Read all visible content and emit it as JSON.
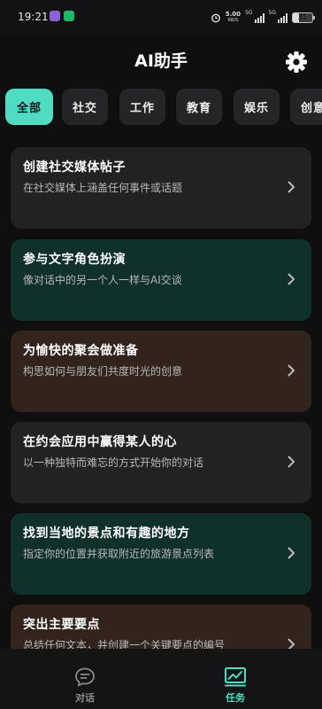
{
  "status_bar": {
    "time": "19:21",
    "net_speed": "5.00",
    "net_unit": "KB/S",
    "sim1_tag": "5G",
    "sim2_tag": "5G",
    "battery": "31"
  },
  "header": {
    "title": "AI助手"
  },
  "tabs": [
    {
      "label": "全部",
      "active": true
    },
    {
      "label": "社交",
      "active": false
    },
    {
      "label": "工作",
      "active": false
    },
    {
      "label": "教育",
      "active": false
    },
    {
      "label": "娱乐",
      "active": false
    },
    {
      "label": "创意",
      "active": false
    }
  ],
  "cards": [
    {
      "title": "创建社交媒体帖子",
      "subtitle": "在社交媒体上涵盖任何事件或话题",
      "color": "#222223"
    },
    {
      "title": "参与文字角色扮演",
      "subtitle": "像对话中的另一个人一样与AI交谈",
      "color": "#10302c"
    },
    {
      "title": "为愉快的聚会做准备",
      "subtitle": "构思如何与朋友们共度时光的创意",
      "color": "#32241c"
    },
    {
      "title": "在约会应用中赢得某人的心",
      "subtitle": "以一种独特而难忘的方式开始你的对话",
      "color": "#222223"
    },
    {
      "title": "找到当地的景点和有趣的地方",
      "subtitle": "指定你的位置并获取附近的旅游景点列表",
      "color": "#10302c"
    },
    {
      "title": "突出主要要点",
      "subtitle": "总结任何文本，并创建一个关键要点的编号",
      "color": "#32241c"
    }
  ],
  "bottom_nav": [
    {
      "label": "对话",
      "icon": "chat-bubble-icon",
      "active": false
    },
    {
      "label": "任务",
      "icon": "chart-line-icon",
      "active": true
    }
  ],
  "colors": {
    "accent": "#4fdcc2",
    "background": "#0f0f10",
    "tab_bg": "#252527",
    "card_dark": "#222223",
    "card_teal": "#10302c",
    "card_brown": "#32241c"
  }
}
